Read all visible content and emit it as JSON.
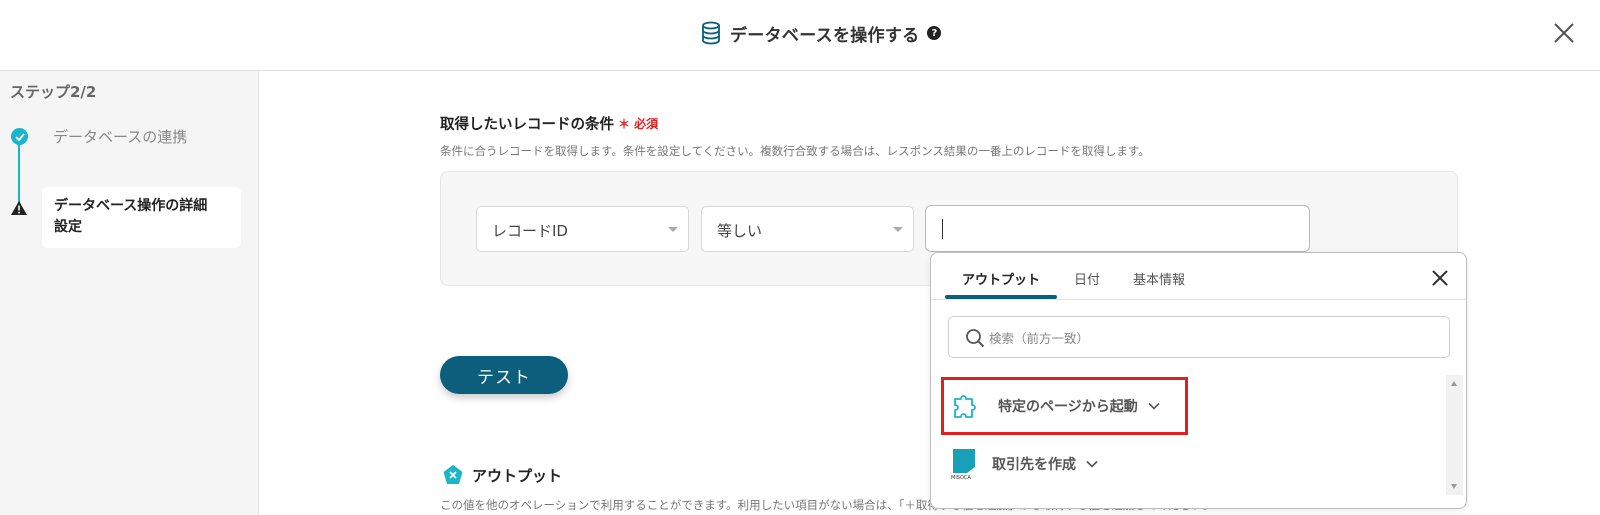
{
  "header": {
    "title": "データベースを操作する",
    "help_glyph": "?",
    "icon": "database-icon",
    "close_icon": "close-icon"
  },
  "sidebar": {
    "step_counter": "ステップ2/2",
    "steps": [
      {
        "label": "データベースの連携",
        "status": "completed",
        "icon": "check-icon"
      },
      {
        "label_line1": "データベース操作の詳細",
        "label_line2": "設定",
        "status": "warning",
        "icon": "warning-icon"
      }
    ]
  },
  "condition_section": {
    "title": "取得したいレコードの条件",
    "required_label": "＊ 必須",
    "description": "条件に合うレコードを取得します。条件を設定してください。複数行合致する場合は、レスポンス結果の一番上のレコードを取得します。",
    "field_select": "レコードID",
    "operator_select": "等しい",
    "value": ""
  },
  "test_button": "テスト",
  "output_section": {
    "title": "アウトプット",
    "description": "この値を他のオペレーションで利用することができます。利用したい項目がない場合は、「＋取得する値を追加」から取得する値を追加してください。"
  },
  "popup": {
    "tabs": [
      "アウトプット",
      "日付",
      "基本情報"
    ],
    "active_tab": "アウトプット",
    "search_placeholder": "検索（前方一致）",
    "items": [
      {
        "label": "特定のページから起動",
        "icon": "puzzle-icon",
        "highlighted": true
      },
      {
        "label": "取引先を作成",
        "icon": "misoca-icon",
        "highlighted": false
      }
    ],
    "misoca_text": "MISOCA"
  },
  "colors": {
    "accent": "#0b5f7c",
    "teal": "#19b5c8",
    "highlight": "#e11f1f",
    "required": "#e02020"
  }
}
